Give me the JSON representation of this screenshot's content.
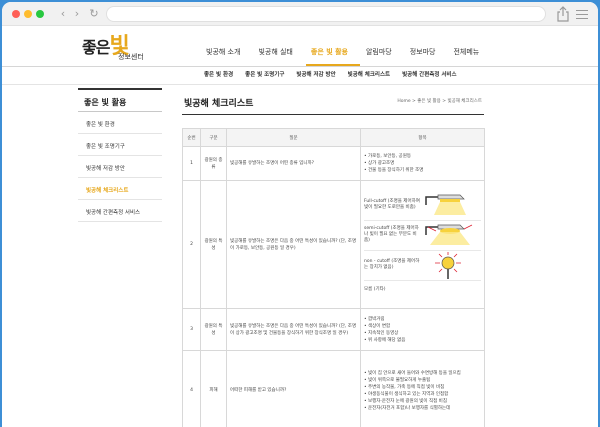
{
  "browser": {
    "back": "‹",
    "forward": "›",
    "reload": "↻"
  },
  "logo": {
    "part1": "좋은",
    "part2": "빛",
    "sub": "정보센터"
  },
  "gnb": [
    "빛공해 소개",
    "빛공해 실태",
    "좋은 빛 활용",
    "알림마당",
    "정보마당",
    "전체메뉴"
  ],
  "lnb": [
    "좋은 빛 환경",
    "좋은 빛 조명기구",
    "빛공해 저감 방안",
    "빛공해 체크리스트",
    "빛공해 간편측정 서비스"
  ],
  "sidebar": {
    "title": "좋은 빛 활용",
    "items": [
      "좋은 빛 환경",
      "좋은 빛 조명기구",
      "빛공해 저감 방안",
      "빛공해 체크리스트",
      "빛공해 간편측정 서비스"
    ]
  },
  "content": {
    "title": "빛공해 체크리스트",
    "breadcrumb": "Home > 좋은 빛 활용 > 빛공해 체크리스트"
  },
  "table": {
    "headers": [
      "순번",
      "구분",
      "질문",
      "항목"
    ],
    "rows": [
      {
        "no": "1",
        "category": "광원의 종류",
        "question": "빛공해를 유발하는 조명이 어떤 종류 입니까?",
        "items": [
          "가로등, 보안등, 공원등",
          "상가 광고조명",
          "건물 등을 장식하기 위한 조명"
        ]
      },
      {
        "no": "2",
        "category": "광원의 특성",
        "question": "빛공해를 유발하는 조명은 다음 중 어떤 특성이 있습니까? (단, 조명이 가로등, 보안등, 공원등 일 경우)",
        "shields": [
          "Full-cutoff (조명을 제어하여 빛이 필요한 도로만을 비춤)",
          "semi-cutoff (조명을 제어하나 빛이 필요 없는 부분도 비춤)",
          "non - cutoff (조명을 제어하는 장치가 없음)"
        ],
        "other": "모름 (기타)"
      },
      {
        "no": "3",
        "category": "광원의 특성",
        "question": "빛공해를 유발하는 조명은 다음 중 어떤 특성이 있습니까? (단, 조명이 상가 광고조명 및 건물등을 장식하기 위한 장식조명 일 경우)",
        "items": [
          "깜박거림",
          "색상이 변함",
          "지속적인 동영상",
          "위 사항에 해당 없음"
        ]
      },
      {
        "no": "4",
        "category": "피해",
        "question": "어떠한 피해를 받고 있습니까?",
        "items": [
          "빛이 집 안으로 새어 들어와 수면방해 등을 일으킴",
          "빛이 위쪽으로 불필요하게 누출됨",
          "주변의 농작물, 가축 등에 직접 빛이 비침",
          "야생동식물이 생식하고 있는 지역과 인접함",
          "보행자·운전자 눈에 광원의 빛이 직접 비침",
          "운전자(자전거 포함)나 보행자를 식별하는데"
        ]
      }
    ]
  },
  "colors": {
    "accent": "#e7a81d",
    "desktop": "#3d8fd6"
  }
}
